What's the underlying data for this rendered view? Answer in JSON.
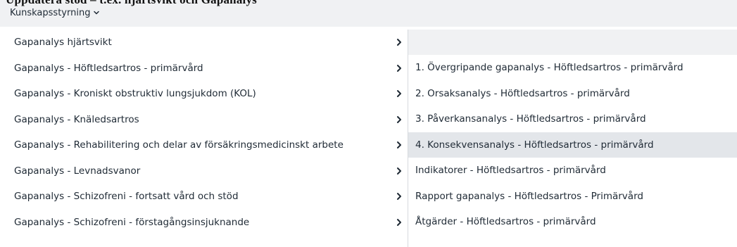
{
  "clipped_heading": "Uppdatera stöd – t.ex. hjärtsvikt och Gapanalys",
  "menu": {
    "trigger_label": "Kunskapsstyrning",
    "trigger_icon": "chevron-down-icon"
  },
  "level1": {
    "items": [
      {
        "label": "Gapanalys hjärtsvikt"
      },
      {
        "label": "Gapanalys - Höftledsartros - primärvård"
      },
      {
        "label": "Gapanalys - Kroniskt obstruktiv lungsjukdom (KOL)"
      },
      {
        "label": "Gapanalys - Knäledsartros"
      },
      {
        "label": "Gapanalys - Rehabilitering och delar av försäkringsmedicinskt arbete"
      },
      {
        "label": "Gapanalys - Levnadsvanor"
      },
      {
        "label": "Gapanalys - Schizofreni - fortsatt vård och stöd"
      },
      {
        "label": "Gapanalys - Schizofreni - förstagångsinsjuknande"
      }
    ],
    "arrow_icon": "chevron-right-icon"
  },
  "level2": {
    "items": [
      {
        "label": "1. Övergripande gapanalys - Höftledsartros - primärvård"
      },
      {
        "label": "2. Orsaksanalys - Höftledsartros - primärvård"
      },
      {
        "label": "3. Påverkansanalys - Höftledsartros - primärvård"
      },
      {
        "label": "4. Konsekvensanalys - Höftledsartros - primärvård",
        "active": true
      },
      {
        "label": "Indikatorer - Höftledsartros - primärvård"
      },
      {
        "label": "Rapport gapanalys - Höftledsartros - Primärvård"
      },
      {
        "label": "Åtgärder - Höftledsartros - primärvård"
      }
    ]
  },
  "colors": {
    "topbar_bg": "#f0f1f3",
    "text": "#1f2a35",
    "active_bg": "#e3e6ea",
    "border": "#d6d9de"
  }
}
